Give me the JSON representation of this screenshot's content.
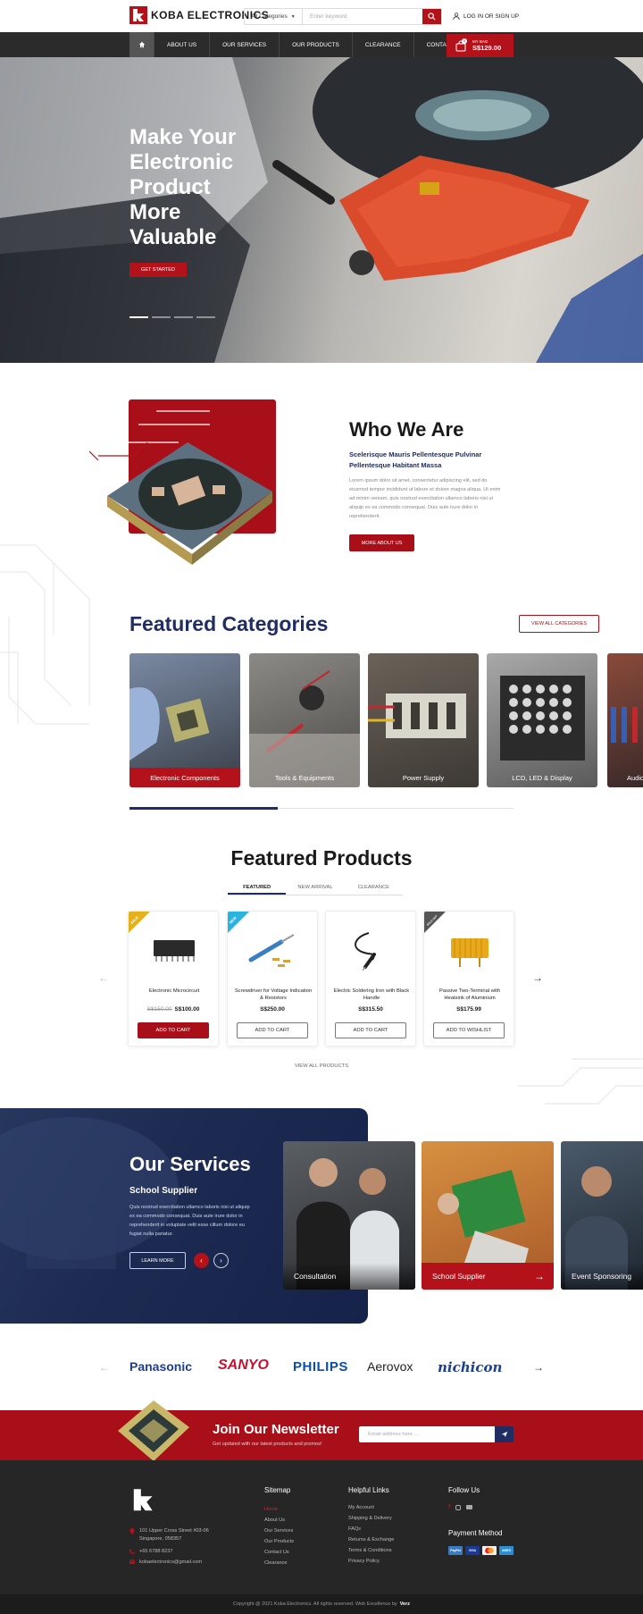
{
  "header": {
    "logo_text": "KOBA ELECTRONICS",
    "search_category": "All Categories",
    "search_placeholder": "Enter keyword",
    "login_label": "LOG IN OR SIGN UP"
  },
  "nav": {
    "items": [
      "ABOUT US",
      "OUR SERVICES",
      "OUR PRODUCTS",
      "CLEARANCE",
      "CONTACT US"
    ],
    "bag_label": "MY BAG",
    "bag_count": "0",
    "bag_total": "S$129.00"
  },
  "hero": {
    "title": "Make Your Electronic Product More Valuable",
    "button": "GET STARTED",
    "slides": 4,
    "active_slide": 1
  },
  "who": {
    "title": "Who We Are",
    "subtitle": "Scelerisque Mauris Pellentesque Pulvinar Pellentesque Habitant Massa",
    "body": "Lorem ipsum dolor sit amet, consectetur adipiscing elit, sed do eiusmod tempor incididunt ut labore et dolore magna aliqua. Ut enim ad minim veniam, quis nostrud exercitation ullamco laboris nisi ut aliquip ex ea commodo consequat. Duis aute irure dolor in reprehenderit.",
    "button": "MORE ABOUT US"
  },
  "categories": {
    "title": "Featured Categories",
    "view_all": "VIEW ALL CATEGORIES",
    "items": [
      "Electronic Components",
      "Tools & Equipments",
      "Power Supply",
      "LCD, LED & Display",
      "Audio"
    ]
  },
  "products": {
    "title": "Featured Products",
    "tabs": [
      "FEATURED",
      "NEW ARRIVAL",
      "CLEARANCE"
    ],
    "items": [
      {
        "badge": "SALE",
        "name": "Electronic Microcircuit",
        "old_price": "S$150.00",
        "price": "S$100.00",
        "button": "ADD TO CART"
      },
      {
        "badge": "NEW",
        "name": "Screwdriver for Voltage Indication & Resistors",
        "old_price": "",
        "price": "S$250.00",
        "button": "ADD TO CART"
      },
      {
        "badge": "",
        "name": "Electric Soldering Iron with Black Handle",
        "old_price": "",
        "price": "S$315.50",
        "button": "ADD TO CART"
      },
      {
        "badge": "SOLD OUT",
        "name": "Passive Two-Terminal with Heatsink of Aluminium",
        "old_price": "",
        "price": "S$175.99",
        "button": "ADD TO WISHLIST"
      }
    ],
    "view_all": "VIEW ALL PRODUCTS"
  },
  "services": {
    "title": "Our Services",
    "subtitle": "School Supplier",
    "body": "Quis nostrud exercitation ullamco laboris nisi ut aliquip ex ea commodo consequat. Duis aute irure dolor in reprehenderit in voluptate velit esse cillum dolore eu fugiat nulla pariatur.",
    "button": "LEARN MORE",
    "cards": [
      "Consultation",
      "School Supplier",
      "Event Sponsoring"
    ]
  },
  "brands": [
    "Panasonic",
    "SANYO",
    "PHILIPS",
    "Aerovox",
    "nichicon"
  ],
  "newsletter": {
    "title": "Join Our Newsletter",
    "subtitle": "Get updated with our latest products and promos!",
    "placeholder": "Email address here ..."
  },
  "footer": {
    "address": "101 Upper Cross Street #03-06 Singapore, 058357",
    "phone": "+65 6788 8237",
    "email": "kobaelectronics@gmail.com",
    "sitemap_title": "Sitemap",
    "sitemap": [
      "Home",
      "About Us",
      "Our Services",
      "Our Products",
      "Contact Us",
      "Clearance"
    ],
    "helpful_title": "Helpful Links",
    "helpful": [
      "My Account",
      "Shipping & Delivery",
      "FAQs",
      "Returns & Exchange",
      "Terms & Conditions",
      "Privacy Policy"
    ],
    "follow_title": "Follow Us",
    "payment_title": "Payment Method",
    "payments": [
      "PayPal",
      "VISA",
      "MC",
      "AMEX"
    ],
    "copyright": "Copyright @ 2021 Koba Electronics. All rights reserved. Web Excellence by",
    "credit": "Verz"
  },
  "colors": {
    "brand_red": "#a80f18",
    "navy": "#1f2d63",
    "nav_dark": "#2b2b2b",
    "footer_dark": "#262626"
  }
}
